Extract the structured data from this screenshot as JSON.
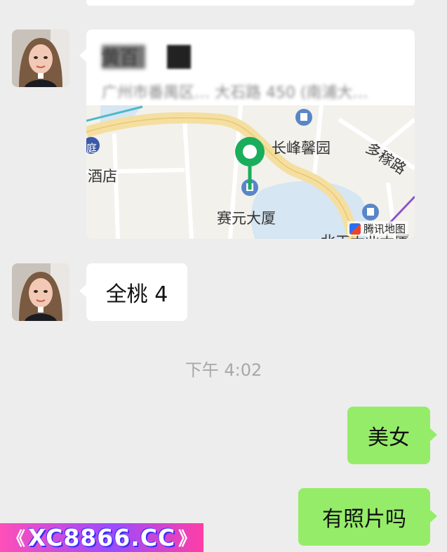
{
  "messages": {
    "location": {
      "title": "黄百",
      "address": "广州市番禺区… 大石路 450 (南浦大…",
      "map": {
        "label_tower": "长峰馨园",
        "label_building": "赛元大厦",
        "label_road": "多稼路",
        "label_hotel": "酒店",
        "label_hotel_badge": "庭",
        "label_partial_bottom": "北工大业大厦",
        "provider": "腾讯地图"
      }
    },
    "incoming_text": "全桃 4",
    "timestamp": "下午 4:02",
    "outgoing_1": "美女",
    "outgoing_2": "有照片吗"
  },
  "watermark": {
    "text": "XC8866.CC",
    "left_chevrons": "《",
    "right_chevrons": "》"
  },
  "colors": {
    "background": "#ededed",
    "outgoing_bubble": "#95ec69",
    "incoming_bubble": "#ffffff",
    "pin": "#1aad5b",
    "road": "#f5dfa0",
    "water": "#d6e6f2"
  }
}
